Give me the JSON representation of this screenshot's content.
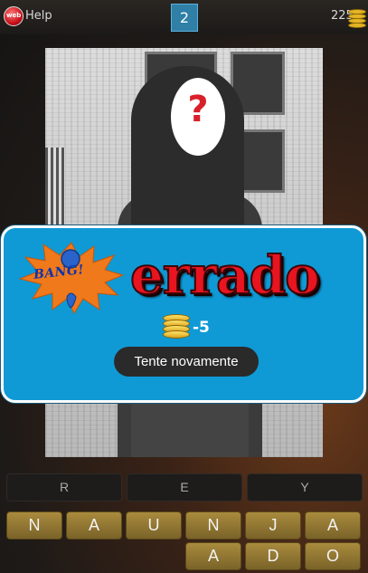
{
  "header": {
    "web_badge": "web",
    "help_label": "Help",
    "level": "2",
    "coins": "225"
  },
  "photo": {
    "face_placeholder": "?"
  },
  "result_dialog": {
    "burst_text": "BANG!",
    "title": "errado",
    "coin_delta": "-5",
    "retry_label": "Tente novamente"
  },
  "answer_slots": [
    "R",
    "E",
    "Y"
  ],
  "letter_keys": {
    "row1": [
      "N",
      "A",
      "U",
      "N",
      "J",
      "A"
    ],
    "row2": [
      "A",
      "D",
      "O"
    ]
  },
  "colors": {
    "dialog_bg": "#0f9ad6",
    "title_red": "#e8141f",
    "key_gold": "#a98b3d",
    "level_blue": "#2f7fa7"
  }
}
